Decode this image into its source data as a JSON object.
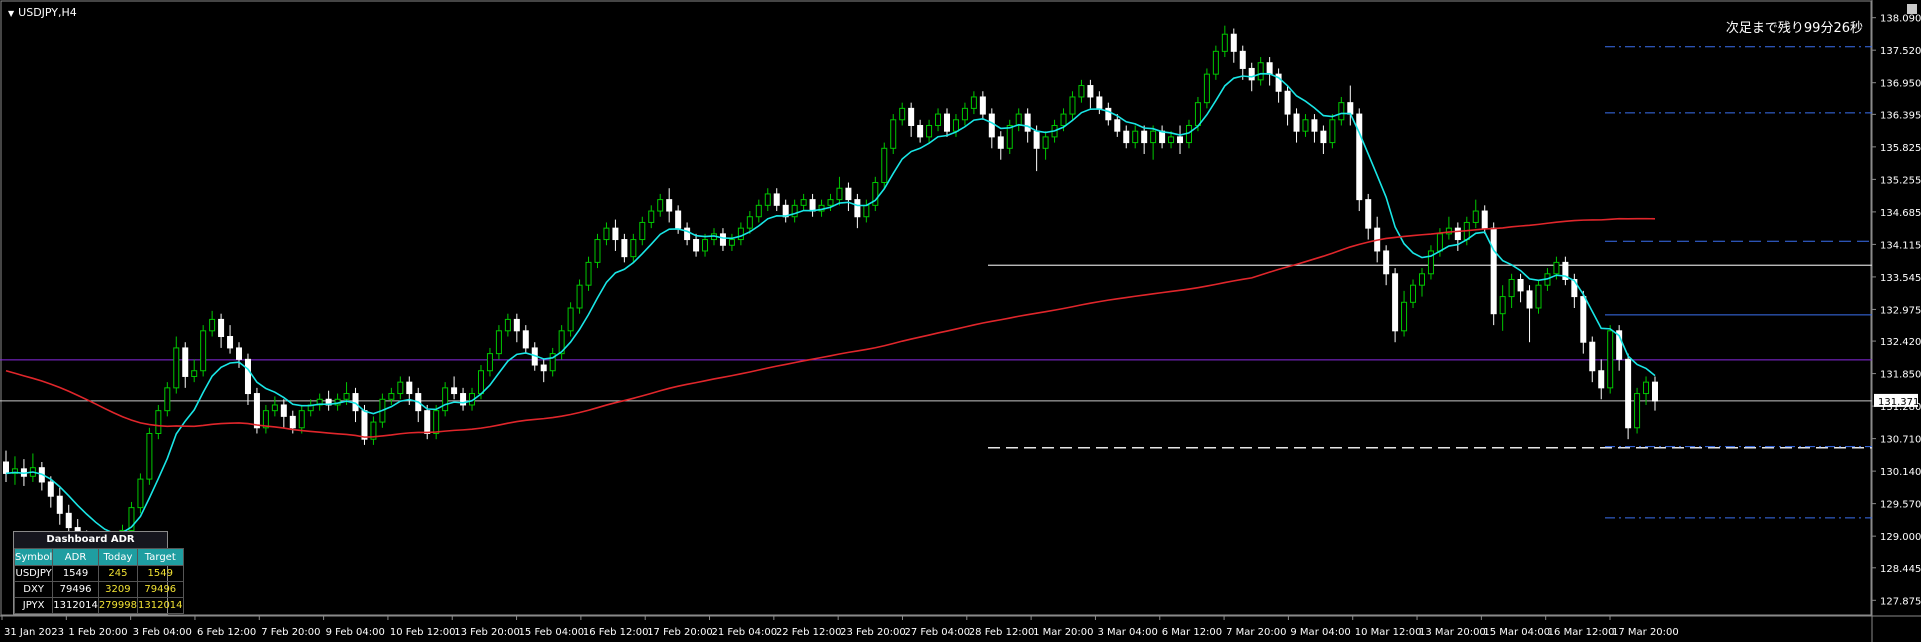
{
  "header": {
    "symbol_title": "USDJPY,H4",
    "countdown": "次足まで残り99分26秒"
  },
  "price_axis": {
    "ticks": [
      "138.090",
      "137.520",
      "136.950",
      "136.395",
      "135.825",
      "135.255",
      "134.685",
      "134.115",
      "133.545",
      "132.975",
      "132.420",
      "131.850",
      "131.280",
      "130.710",
      "130.140",
      "129.570",
      "129.000",
      "128.445",
      "127.875"
    ],
    "current_price": "131.371"
  },
  "time_axis": {
    "labels": [
      "31 Jan 2023",
      "1 Feb 20:00",
      "3 Feb 04:00",
      "6 Feb 12:00",
      "7 Feb 20:00",
      "9 Feb 04:00",
      "10 Feb 12:00",
      "13 Feb 20:00",
      "15 Feb 04:00",
      "16 Feb 12:00",
      "17 Feb 20:00",
      "21 Feb 04:00",
      "22 Feb 12:00",
      "23 Feb 20:00",
      "27 Feb 04:00",
      "28 Feb 12:00",
      "1 Mar 20:00",
      "3 Mar 04:00",
      "6 Mar 12:00",
      "7 Mar 20:00",
      "9 Mar 04:00",
      "10 Mar 12:00",
      "13 Mar 20:00",
      "15 Mar 04:00",
      "16 Mar 12:00",
      "17 Mar 20:00"
    ]
  },
  "colors": {
    "background": "#000000",
    "bull": "#00c800",
    "bear": "#ffffff",
    "ma_fast": "#19e6e6",
    "ma_slow": "#e0262b",
    "purple_line": "#8a2be2",
    "level_blue": "#3a6ff0",
    "grid_text": "#ffffff"
  },
  "chart_data": {
    "type": "candlestick",
    "timeframe": "H4",
    "ylim": [
      127.6,
      138.4
    ],
    "levels": {
      "purple": 132.09,
      "current": 131.371,
      "white_solid": 133.75,
      "white_dashed": 130.55,
      "blue_solid": 132.88,
      "blue_dashdot": [
        137.58,
        136.42,
        130.57,
        129.32
      ],
      "blue_dashed": [
        134.17
      ]
    },
    "candles": [
      [
        130.3,
        130.1,
        130.5,
        129.95
      ],
      [
        130.1,
        130.18,
        130.4,
        129.9
      ],
      [
        130.18,
        130.05,
        130.35,
        129.88
      ],
      [
        130.05,
        130.2,
        130.45,
        129.95
      ],
      [
        130.2,
        129.95,
        130.3,
        129.8
      ],
      [
        129.95,
        129.7,
        130.05,
        129.5
      ],
      [
        129.7,
        129.4,
        129.85,
        129.2
      ],
      [
        129.4,
        129.15,
        129.55,
        129.0
      ],
      [
        129.15,
        128.95,
        129.3,
        128.8
      ],
      [
        128.95,
        128.85,
        129.1,
        128.7
      ],
      [
        128.85,
        128.75,
        129.0,
        128.6
      ],
      [
        128.75,
        128.7,
        128.9,
        128.55
      ],
      [
        128.7,
        128.8,
        128.95,
        128.6
      ],
      [
        128.8,
        129.1,
        129.2,
        128.7
      ],
      [
        129.1,
        129.5,
        129.6,
        129.0
      ],
      [
        129.5,
        130.0,
        130.1,
        129.4
      ],
      [
        130.0,
        130.8,
        130.9,
        129.9
      ],
      [
        130.8,
        131.2,
        131.3,
        130.7
      ],
      [
        131.2,
        131.6,
        131.7,
        131.1
      ],
      [
        131.6,
        132.3,
        132.5,
        131.5
      ],
      [
        132.3,
        131.8,
        132.4,
        131.6
      ],
      [
        131.8,
        131.9,
        132.1,
        131.7
      ],
      [
        131.9,
        132.6,
        132.7,
        131.8
      ],
      [
        132.6,
        132.8,
        132.95,
        132.5
      ],
      [
        132.8,
        132.5,
        132.9,
        132.3
      ],
      [
        132.5,
        132.3,
        132.7,
        132.2
      ],
      [
        132.3,
        132.1,
        132.4,
        131.95
      ],
      [
        132.1,
        131.5,
        132.2,
        131.3
      ],
      [
        131.5,
        130.9,
        131.6,
        130.8
      ],
      [
        130.9,
        131.2,
        131.3,
        130.8
      ],
      [
        131.2,
        131.3,
        131.45,
        131.1
      ],
      [
        131.3,
        131.1,
        131.4,
        130.9
      ],
      [
        131.1,
        130.9,
        131.2,
        130.8
      ],
      [
        130.9,
        131.2,
        131.3,
        130.8
      ],
      [
        131.2,
        131.3,
        131.4,
        131.1
      ],
      [
        131.3,
        131.4,
        131.5,
        131.2
      ],
      [
        131.4,
        131.3,
        131.55,
        131.2
      ],
      [
        131.3,
        131.4,
        131.5,
        131.2
      ],
      [
        131.4,
        131.5,
        131.7,
        131.3
      ],
      [
        131.5,
        131.2,
        131.6,
        131.0
      ],
      [
        131.2,
        130.7,
        131.3,
        130.6
      ],
      [
        130.7,
        131.0,
        131.1,
        130.6
      ],
      [
        131.0,
        131.4,
        131.5,
        130.9
      ],
      [
        131.4,
        131.5,
        131.6,
        131.3
      ],
      [
        131.5,
        131.7,
        131.8,
        131.4
      ],
      [
        131.7,
        131.5,
        131.8,
        131.3
      ],
      [
        131.5,
        131.2,
        131.6,
        131.0
      ],
      [
        131.2,
        130.8,
        131.3,
        130.7
      ],
      [
        130.8,
        131.2,
        131.3,
        130.7
      ],
      [
        131.2,
        131.6,
        131.7,
        131.1
      ],
      [
        131.6,
        131.5,
        131.8,
        131.4
      ],
      [
        131.5,
        131.3,
        131.6,
        131.2
      ],
      [
        131.3,
        131.5,
        131.6,
        131.2
      ],
      [
        131.5,
        131.9,
        132.0,
        131.4
      ],
      [
        131.9,
        132.2,
        132.3,
        131.8
      ],
      [
        132.2,
        132.6,
        132.7,
        132.1
      ],
      [
        132.6,
        132.8,
        132.9,
        132.5
      ],
      [
        132.8,
        132.6,
        132.9,
        132.4
      ],
      [
        132.6,
        132.3,
        132.7,
        132.2
      ],
      [
        132.3,
        132.0,
        132.4,
        131.9
      ],
      [
        132.0,
        131.9,
        132.1,
        131.7
      ],
      [
        131.9,
        132.2,
        132.3,
        131.8
      ],
      [
        132.2,
        132.6,
        132.7,
        132.1
      ],
      [
        132.6,
        133.0,
        133.1,
        132.5
      ],
      [
        133.0,
        133.4,
        133.5,
        132.9
      ],
      [
        133.4,
        133.8,
        133.9,
        133.3
      ],
      [
        133.8,
        134.2,
        134.3,
        133.7
      ],
      [
        134.2,
        134.4,
        134.5,
        134.1
      ],
      [
        134.4,
        134.2,
        134.55,
        134.0
      ],
      [
        134.2,
        133.9,
        134.3,
        133.8
      ],
      [
        133.9,
        134.2,
        134.3,
        133.8
      ],
      [
        134.2,
        134.5,
        134.6,
        134.1
      ],
      [
        134.5,
        134.7,
        134.8,
        134.4
      ],
      [
        134.7,
        134.9,
        135.0,
        134.6
      ],
      [
        134.9,
        134.7,
        135.1,
        134.5
      ],
      [
        134.7,
        134.4,
        134.8,
        134.3
      ],
      [
        134.4,
        134.2,
        134.5,
        134.1
      ],
      [
        134.2,
        134.0,
        134.3,
        133.9
      ],
      [
        134.0,
        134.2,
        134.3,
        133.9
      ],
      [
        134.2,
        134.3,
        134.4,
        134.1
      ],
      [
        134.3,
        134.1,
        134.4,
        134.0
      ],
      [
        134.1,
        134.2,
        134.3,
        134.0
      ],
      [
        134.2,
        134.4,
        134.5,
        134.1
      ],
      [
        134.4,
        134.6,
        134.7,
        134.3
      ],
      [
        134.6,
        134.8,
        134.9,
        134.5
      ],
      [
        134.8,
        135.0,
        135.1,
        134.7
      ],
      [
        135.0,
        134.8,
        135.1,
        134.7
      ],
      [
        134.8,
        134.6,
        134.9,
        134.5
      ],
      [
        134.6,
        134.8,
        134.9,
        134.5
      ],
      [
        134.8,
        134.9,
        135.0,
        134.7
      ],
      [
        134.9,
        134.7,
        135.0,
        134.6
      ],
      [
        134.7,
        134.8,
        134.9,
        134.6
      ],
      [
        134.8,
        134.9,
        135.0,
        134.7
      ],
      [
        134.9,
        135.1,
        135.3,
        134.8
      ],
      [
        135.1,
        134.9,
        135.2,
        134.7
      ],
      [
        134.9,
        134.6,
        135.0,
        134.4
      ],
      [
        134.6,
        134.8,
        134.9,
        134.5
      ],
      [
        134.8,
        135.2,
        135.3,
        134.7
      ],
      [
        135.2,
        135.8,
        135.9,
        135.1
      ],
      [
        135.8,
        136.3,
        136.4,
        135.7
      ],
      [
        136.3,
        136.5,
        136.6,
        136.2
      ],
      [
        136.5,
        136.2,
        136.6,
        136.0
      ],
      [
        136.2,
        136.0,
        136.3,
        135.9
      ],
      [
        136.0,
        136.2,
        136.3,
        135.9
      ],
      [
        136.2,
        136.4,
        136.5,
        136.1
      ],
      [
        136.4,
        136.1,
        136.5,
        136.0
      ],
      [
        136.1,
        136.3,
        136.4,
        136.0
      ],
      [
        136.3,
        136.5,
        136.6,
        136.2
      ],
      [
        136.5,
        136.7,
        136.8,
        136.4
      ],
      [
        136.7,
        136.4,
        136.8,
        136.3
      ],
      [
        136.4,
        136.0,
        136.5,
        135.8
      ],
      [
        136.0,
        135.8,
        136.1,
        135.6
      ],
      [
        135.8,
        136.2,
        136.3,
        135.7
      ],
      [
        136.2,
        136.4,
        136.5,
        136.1
      ],
      [
        136.4,
        136.1,
        136.5,
        135.9
      ],
      [
        136.1,
        135.8,
        136.2,
        135.4
      ],
      [
        135.8,
        136.0,
        136.1,
        135.6
      ],
      [
        136.0,
        136.2,
        136.3,
        135.9
      ],
      [
        136.2,
        136.4,
        136.5,
        136.1
      ],
      [
        136.4,
        136.7,
        136.8,
        136.3
      ],
      [
        136.7,
        136.9,
        137.0,
        136.6
      ],
      [
        136.9,
        136.7,
        137.0,
        136.5
      ],
      [
        136.7,
        136.5,
        136.8,
        136.4
      ],
      [
        136.5,
        136.3,
        136.6,
        136.2
      ],
      [
        136.3,
        136.1,
        136.4,
        136.0
      ],
      [
        136.1,
        135.9,
        136.2,
        135.8
      ],
      [
        135.9,
        136.1,
        136.2,
        135.8
      ],
      [
        136.1,
        135.9,
        136.2,
        135.7
      ],
      [
        135.9,
        136.1,
        136.2,
        135.6
      ],
      [
        136.1,
        135.9,
        136.2,
        135.8
      ],
      [
        135.9,
        136.0,
        136.1,
        135.8
      ],
      [
        136.0,
        135.9,
        136.2,
        135.7
      ],
      [
        135.9,
        136.2,
        136.3,
        135.8
      ],
      [
        136.2,
        136.6,
        136.7,
        136.1
      ],
      [
        136.6,
        137.1,
        137.2,
        136.5
      ],
      [
        137.1,
        137.5,
        137.6,
        137.0
      ],
      [
        137.5,
        137.8,
        137.95,
        137.4
      ],
      [
        137.8,
        137.5,
        137.9,
        137.3
      ],
      [
        137.5,
        137.2,
        137.6,
        137.0
      ],
      [
        137.2,
        137.0,
        137.3,
        136.8
      ],
      [
        137.0,
        137.3,
        137.4,
        136.9
      ],
      [
        137.3,
        137.1,
        137.4,
        136.9
      ],
      [
        137.1,
        136.8,
        137.2,
        136.6
      ],
      [
        136.8,
        136.4,
        136.9,
        136.2
      ],
      [
        136.4,
        136.1,
        136.5,
        135.9
      ],
      [
        136.1,
        136.3,
        136.4,
        136.0
      ],
      [
        136.3,
        136.1,
        136.4,
        135.9
      ],
      [
        136.1,
        135.9,
        136.2,
        135.7
      ],
      [
        135.9,
        136.3,
        136.4,
        135.8
      ],
      [
        136.3,
        136.6,
        136.7,
        136.2
      ],
      [
        136.6,
        136.4,
        136.9,
        136.2
      ],
      [
        136.4,
        134.9,
        136.5,
        134.7
      ],
      [
        134.9,
        134.4,
        135.0,
        134.2
      ],
      [
        134.4,
        134.0,
        134.6,
        133.8
      ],
      [
        134.0,
        133.6,
        134.1,
        133.4
      ],
      [
        133.6,
        132.6,
        133.7,
        132.4
      ],
      [
        132.6,
        133.1,
        133.3,
        132.5
      ],
      [
        133.1,
        133.4,
        133.5,
        133.0
      ],
      [
        133.4,
        133.6,
        133.7,
        133.2
      ],
      [
        133.6,
        134.0,
        134.1,
        133.5
      ],
      [
        134.0,
        134.3,
        134.4,
        133.9
      ],
      [
        134.3,
        134.4,
        134.6,
        134.2
      ],
      [
        134.4,
        134.2,
        134.5,
        134.0
      ],
      [
        134.2,
        134.5,
        134.6,
        134.1
      ],
      [
        134.5,
        134.7,
        134.9,
        134.4
      ],
      [
        134.7,
        134.4,
        134.8,
        134.3
      ],
      [
        134.4,
        132.9,
        134.5,
        132.7
      ],
      [
        132.9,
        133.2,
        133.4,
        132.6
      ],
      [
        133.2,
        133.5,
        133.6,
        133.0
      ],
      [
        133.5,
        133.3,
        133.6,
        133.1
      ],
      [
        133.3,
        133.0,
        133.4,
        132.4
      ],
      [
        133.0,
        133.4,
        133.5,
        132.9
      ],
      [
        133.4,
        133.6,
        133.7,
        133.3
      ],
      [
        133.6,
        133.8,
        133.9,
        133.5
      ],
      [
        133.8,
        133.5,
        133.9,
        133.4
      ],
      [
        133.5,
        133.2,
        133.6,
        133.0
      ],
      [
        133.2,
        132.4,
        133.3,
        132.2
      ],
      [
        132.4,
        131.9,
        132.5,
        131.7
      ],
      [
        131.9,
        131.6,
        132.1,
        131.4
      ],
      [
        131.6,
        132.6,
        132.7,
        131.5
      ],
      [
        132.6,
        132.1,
        132.7,
        131.9
      ],
      [
        132.1,
        130.9,
        132.2,
        130.7
      ],
      [
        130.9,
        131.5,
        131.6,
        130.8
      ],
      [
        131.5,
        131.7,
        131.8,
        131.3
      ],
      [
        131.7,
        131.37,
        131.8,
        131.2
      ]
    ],
    "ma_fast_label": "",
    "ma_slow_label": ""
  },
  "dashboard": {
    "title": "Dashboard ADR",
    "headers": [
      "Symbol",
      "ADR",
      "Today",
      "Target"
    ],
    "rows": [
      [
        "USDJPY",
        "1549",
        "245",
        "1549"
      ],
      [
        "DXY",
        "79496",
        "3209",
        "79496"
      ],
      [
        "JPYX",
        "1312014",
        "279998",
        "1312014"
      ]
    ]
  }
}
